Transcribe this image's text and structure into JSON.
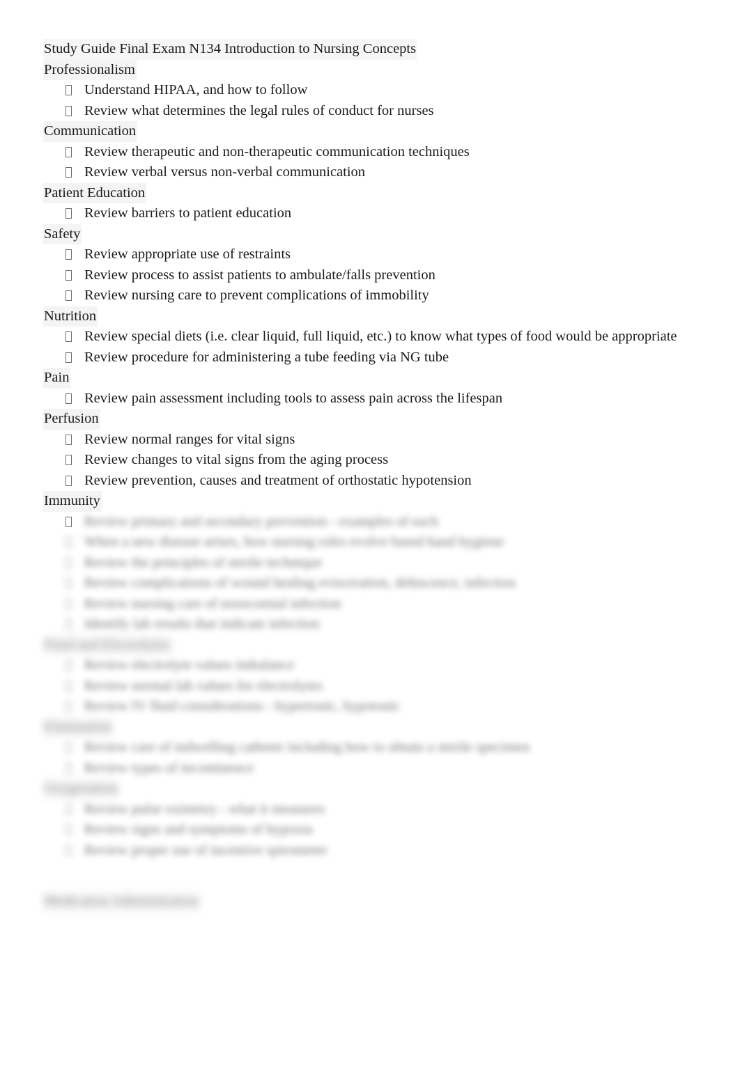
{
  "document": {
    "title": "Study Guide Final Exam N134 Introduction to Nursing Concepts",
    "bullet_glyph": " ",
    "bullet_icon_name": "missing-glyph-box-bullet",
    "highlight_color": "#f0f0f0",
    "text_color": "#1b1b1b",
    "page_background": "#ffffff"
  },
  "sections": [
    {
      "heading": "Professionalism",
      "blurred": false,
      "items": [
        {
          "text": "Understand HIPAA, and how to follow",
          "blurred": false
        },
        {
          "text": "Review what determines the legal rules of conduct for nurses",
          "blurred": false
        }
      ]
    },
    {
      "heading": "Communication",
      "blurred": false,
      "items": [
        {
          "text": "Review therapeutic and non-therapeutic communication techniques",
          "blurred": false
        },
        {
          "text": "Review verbal versus non-verbal communication",
          "blurred": false
        }
      ]
    },
    {
      "heading": "Patient Education",
      "blurred": false,
      "items": [
        {
          "text": "Review barriers to patient education",
          "blurred": false
        }
      ]
    },
    {
      "heading": "Safety",
      "blurred": false,
      "items": [
        {
          "text": "Review appropriate use of restraints",
          "blurred": false
        },
        {
          "text": "Review process to assist patients to ambulate/falls prevention",
          "blurred": false
        },
        {
          "text": "Review nursing care to prevent complications of immobility",
          "blurred": false
        }
      ]
    },
    {
      "heading": "Nutrition",
      "blurred": false,
      "items": [
        {
          "text": "Review special diets (i.e. clear liquid, full liquid, etc.) to know what types of food would be appropriate",
          "blurred": false
        },
        {
          "text": "Review procedure for administering a tube feeding via NG tube",
          "blurred": false
        }
      ]
    },
    {
      "heading": "Pain",
      "blurred": false,
      "items": [
        {
          "text": "Review pain assessment including tools to assess pain across the lifespan",
          "blurred": false
        }
      ]
    },
    {
      "heading": "Perfusion",
      "blurred": false,
      "items": [
        {
          "text": "Review normal ranges for vital signs",
          "blurred": false
        },
        {
          "text": "Review changes to vital signs from the aging process",
          "blurred": false
        },
        {
          "text": "Review prevention, causes and treatment of orthostatic hypotension",
          "blurred": false
        }
      ]
    },
    {
      "heading": "Immunity",
      "blurred": false,
      "items": [
        {
          "text": "Review primary and secondary prevention - examples of each",
          "blurred": true
        },
        {
          "text": "When a new disease arises, how nursing roles evolve based hand hygiene",
          "blurred": true
        },
        {
          "text": "Review the principles of sterile technique",
          "blurred": true
        },
        {
          "text": "Review complications of wound healing evisceration, dehiscence, infection",
          "blurred": true
        },
        {
          "text": "Review nursing care of nosocomial infection",
          "blurred": true
        },
        {
          "text": "Identify lab results that indicate infection",
          "blurred": true
        }
      ]
    },
    {
      "heading": "Fluid and Electrolytes",
      "blurred": true,
      "items": [
        {
          "text": "Review electrolyte values imbalance",
          "blurred": true
        },
        {
          "text": "Review normal lab values for electrolytes",
          "blurred": true
        },
        {
          "text": "Review IV fluid considerations - hypertonic, hypotonic",
          "blurred": true
        }
      ]
    },
    {
      "heading": "Elimination",
      "blurred": true,
      "items": [
        {
          "text": "Review care of indwelling catheter including how to obtain a sterile specimen",
          "blurred": true
        },
        {
          "text": "Review types of incontinence",
          "blurred": true
        }
      ]
    },
    {
      "heading": "Oxygenation",
      "blurred": true,
      "items": [
        {
          "text": "Review pulse oximetry - what it measures",
          "blurred": true
        },
        {
          "text": "Review signs and symptoms of hypoxia",
          "blurred": true
        },
        {
          "text": "Review proper use of incentive spirometer",
          "blurred": true
        }
      ]
    },
    {
      "heading": "Medication Administration",
      "blurred": true,
      "items": []
    }
  ]
}
